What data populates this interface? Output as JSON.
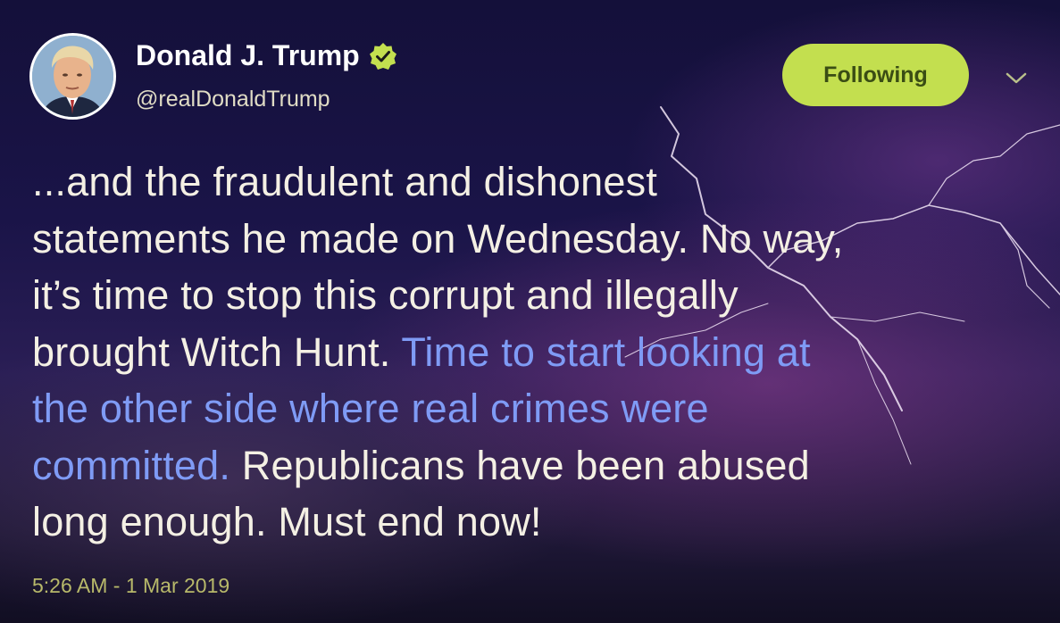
{
  "author": {
    "display_name": "Donald J. Trump",
    "handle": "@realDonaldTrump",
    "verified": true
  },
  "actions": {
    "follow_label": "Following",
    "menu_icon": "chevron-down-icon"
  },
  "tweet": {
    "line1": "...and the fraudulent and dishonest",
    "line2": "statements he made on Wednesday. No way,",
    "line3": "it’s time to stop this corrupt and illegally",
    "line4_plain": "brought Witch Hunt. ",
    "line4_highlight": "Time to start looking at",
    "line5_highlight": "the other side where real crimes were",
    "line6_highlight": "committed.",
    "line6_plain": " Republicans have been abused",
    "line7": "long enough. Must end now!"
  },
  "timestamp": "5:26 AM - 1 Mar 2019",
  "colors": {
    "follow_button": "#c3df4f",
    "highlight_text": "#7f9bf5",
    "verified_badge": "#c3df4f"
  }
}
